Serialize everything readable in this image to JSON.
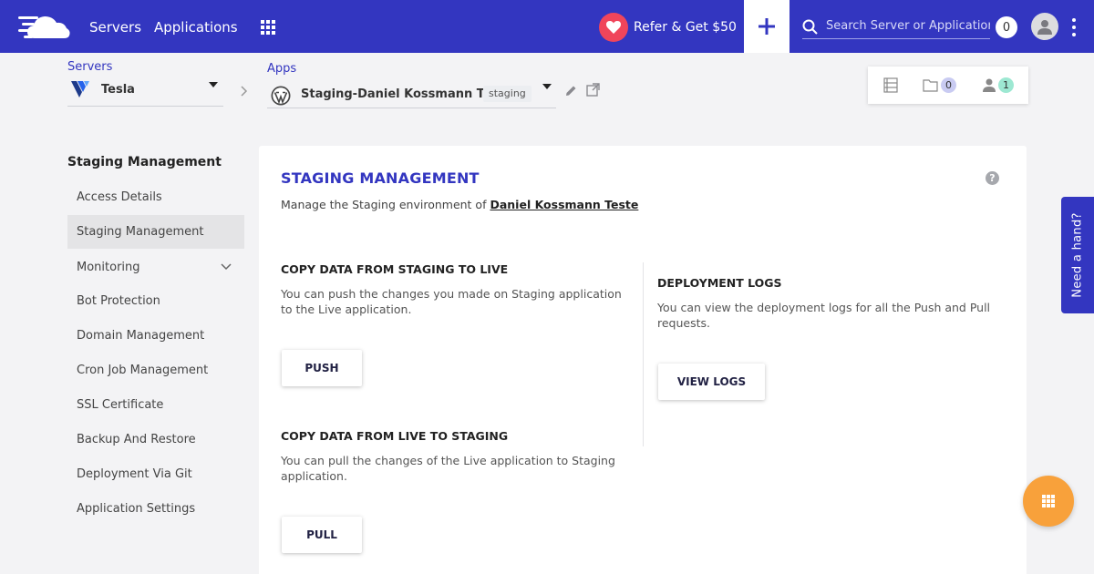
{
  "topbar": {
    "nav": [
      "Servers",
      "Applications"
    ],
    "refer_label": "Refer & Get $50",
    "search_placeholder": "Search Server or Application",
    "notification_count": "0",
    "colors": {
      "bar": "#3336c0",
      "heart": "#f0455b"
    }
  },
  "breadcrumb": {
    "servers_label": "Servers",
    "server_name": "Tesla",
    "apps_label": "Apps",
    "app_name": "Staging-Daniel Kossmann Teste",
    "app_tag": "staging"
  },
  "quick_panel": {
    "folder_count": "0",
    "members_count": "1"
  },
  "sidebar": {
    "title": "Staging Management",
    "items": [
      {
        "label": "Access Details"
      },
      {
        "label": "Staging Management"
      },
      {
        "label": "Monitoring"
      },
      {
        "label": "Bot Protection"
      },
      {
        "label": "Domain Management"
      },
      {
        "label": "Cron Job Management"
      },
      {
        "label": "SSL Certificate"
      },
      {
        "label": "Backup And Restore"
      },
      {
        "label": "Deployment Via Git"
      },
      {
        "label": "Application Settings"
      }
    ]
  },
  "main": {
    "title": "STAGING MANAGEMENT",
    "subtitle_prefix": "Manage the Staging environment of",
    "subtitle_link": "Daniel Kossmann Teste",
    "push_section": {
      "title": "COPY DATA FROM STAGING TO LIVE",
      "desc": "You can push the changes you made on Staging application to the Live application.",
      "button": "PUSH"
    },
    "pull_section": {
      "title": "COPY DATA FROM LIVE TO STAGING",
      "desc": "You can pull the changes of the Live application to Staging application.",
      "button": "PULL"
    },
    "logs_section": {
      "title": "DEPLOYMENT LOGS",
      "desc": "You can view the deployment logs for all the Push and Pull requests.",
      "button": "VIEW LOGS"
    }
  },
  "help_tab": {
    "label": "Need a hand?"
  }
}
